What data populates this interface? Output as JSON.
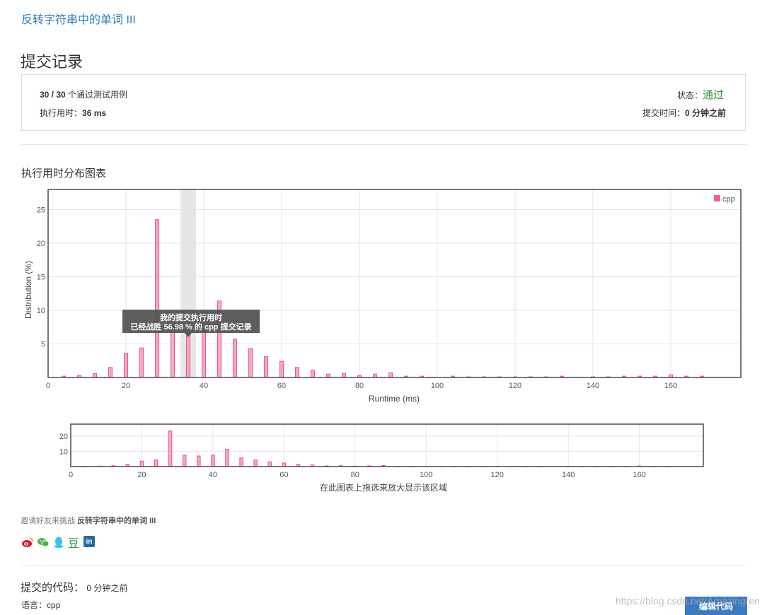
{
  "problem": {
    "title": "反转字符串中的单词 III"
  },
  "page_title": "提交记录",
  "summary": {
    "cases_count": "30 / 30",
    "cases_suffix": " 个通过测试用例",
    "status_label": "状态：",
    "status_value": "通过",
    "runtime_label": "执行用时：",
    "runtime_value": "36 ms",
    "submit_time_label": "提交时间：",
    "submit_time_value": "0 分钟之前"
  },
  "chart_section_title": "执行用时分布图表",
  "chart_data": [
    {
      "type": "bar",
      "title": "",
      "xlabel": "Runtime (ms)",
      "ylabel": "Distribution (%)",
      "xlim": [
        0,
        178
      ],
      "ylim": [
        0,
        28
      ],
      "xticks": [
        "0",
        "20",
        "40",
        "60",
        "80",
        "100",
        "120",
        "140",
        "160"
      ],
      "yticks": [
        "5",
        "10",
        "15",
        "20",
        "25"
      ],
      "grid": true,
      "legend": {
        "position": "top-right",
        "entries": [
          "cpp"
        ]
      },
      "series": [
        {
          "name": "cpp",
          "color": "#ef5f8f",
          "x": [
            4,
            8,
            12,
            16,
            20,
            24,
            28,
            32,
            36,
            40,
            44,
            48,
            52,
            56,
            60,
            64,
            68,
            72,
            76,
            80,
            84,
            88,
            92,
            96,
            104,
            108,
            112,
            116,
            120,
            124,
            128,
            132,
            140,
            144,
            148,
            152,
            156,
            160,
            164,
            168
          ],
          "values": [
            0.2,
            0.3,
            0.6,
            1.5,
            3.6,
            4.4,
            23.5,
            7.5,
            7.0,
            7.5,
            11.4,
            5.7,
            4.3,
            3.1,
            2.4,
            1.5,
            1.1,
            0.5,
            0.6,
            0.3,
            0.5,
            0.7,
            0.2,
            0.2,
            0.2,
            0.1,
            0.1,
            0.1,
            0.1,
            0.1,
            0.1,
            0.2,
            0.1,
            0.1,
            0.2,
            0.2,
            0.2,
            0.4,
            0.2,
            0.2
          ]
        }
      ],
      "highlight": {
        "x": 36,
        "label_line1": "我的提交执行用时",
        "label_line2": "已经战胜 56.98 % 的 cpp 提交记录"
      }
    },
    {
      "type": "bar",
      "xlim": [
        0,
        178
      ],
      "ylim": [
        0,
        28
      ],
      "xticks": [
        "0",
        "20",
        "40",
        "60",
        "80",
        "100",
        "120",
        "140",
        "160"
      ],
      "yticks": [
        "10",
        "20"
      ],
      "caption": "在此图表上拖选来放大显示该区域"
    }
  ],
  "invite": {
    "prefix": "邀请好友来挑战 ",
    "problem": "反转字符串中的单词 III"
  },
  "share_icons": [
    {
      "name": "weibo-icon",
      "color": "#e6162d"
    },
    {
      "name": "wechat-icon",
      "color": "#44b549"
    },
    {
      "name": "qq-icon",
      "color": "#3dbff5"
    },
    {
      "name": "douban-icon",
      "color": "#2e963d",
      "glyph": "豆"
    },
    {
      "name": "linkedin-icon",
      "color": "#2a6a9f",
      "glyph": "in"
    }
  ],
  "code_section": {
    "title": "提交的代码：",
    "time": " 0 分钟之前",
    "lang_label": "语言：",
    "lang_value": "cpp",
    "edit_button": "编辑代码"
  },
  "watermark": "https://blog.csdn.net/Amazingren"
}
